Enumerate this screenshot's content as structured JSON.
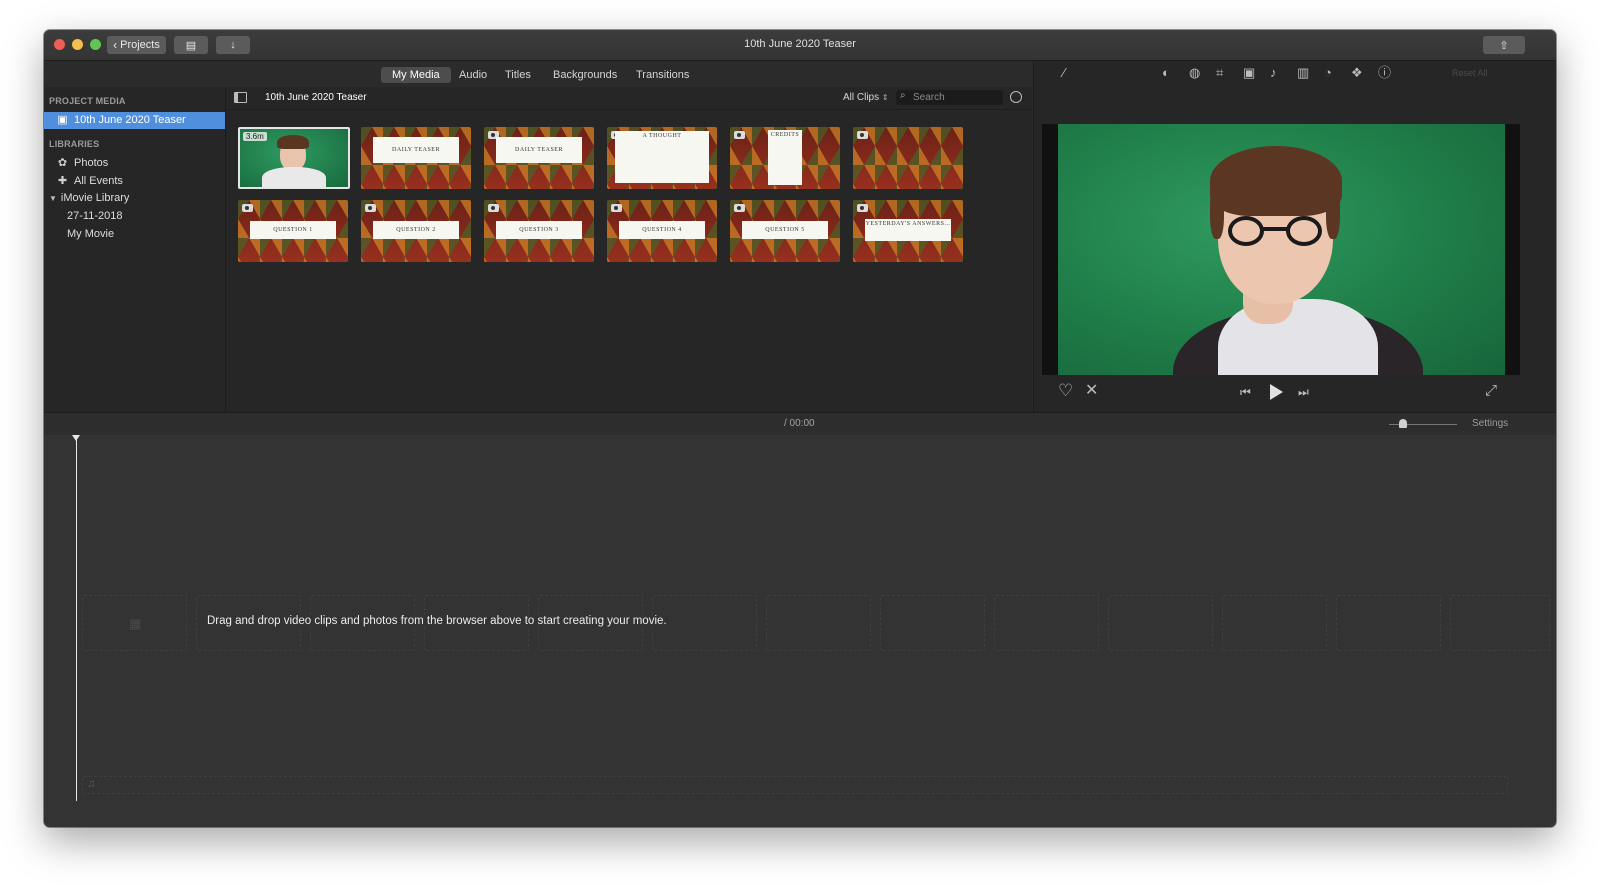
{
  "window": {
    "title": "10th June 2020 Teaser",
    "projects_button": "Projects"
  },
  "tabs": [
    "My Media",
    "Audio",
    "Titles",
    "Backgrounds",
    "Transitions"
  ],
  "sidebar": {
    "project_media_heading": "PROJECT MEDIA",
    "project_item": "10th June 2020 Teaser",
    "libraries_heading": "LIBRARIES",
    "photos": "Photos",
    "all_events": "All Events",
    "imovie_library": "iMovie Library",
    "event_date": "27-11-2018",
    "my_movie": "My Movie"
  },
  "browser": {
    "title": "10th June 2020 Teaser",
    "filter": "All Clips",
    "search_placeholder": "Search",
    "clips": [
      {
        "type": "video",
        "duration": "3.6m"
      },
      {
        "type": "title",
        "text": "DAILY TEASER"
      },
      {
        "type": "title",
        "text": "DAILY TEASER"
      },
      {
        "type": "title",
        "text": "A THOUGHT"
      },
      {
        "type": "title",
        "text": "CREDITS"
      },
      {
        "type": "background",
        "text": ""
      },
      {
        "type": "title",
        "text": "QUESTION 1"
      },
      {
        "type": "title",
        "text": "QUESTION 2"
      },
      {
        "type": "title",
        "text": "QUESTION 3"
      },
      {
        "type": "title",
        "text": "QUESTION 4"
      },
      {
        "type": "title",
        "text": "QUESTION 5"
      },
      {
        "type": "title",
        "text": "YESTERDAY'S ANSWERS..."
      }
    ]
  },
  "viewer": {
    "reset_all": "Reset All",
    "toolbar_icons": [
      "magic-wand-icon",
      "color-balance-icon",
      "color-correction-icon",
      "crop-icon",
      "stabilization-icon",
      "volume-icon",
      "equalizer-icon",
      "speed-icon",
      "clip-filter-icon",
      "info-icon"
    ]
  },
  "timeline": {
    "timecode": "/ 00:00",
    "settings": "Settings",
    "zoom_level": 0.2,
    "drop_hint": "Drag and drop video clips and photos from the browser above to start creating your movie."
  }
}
